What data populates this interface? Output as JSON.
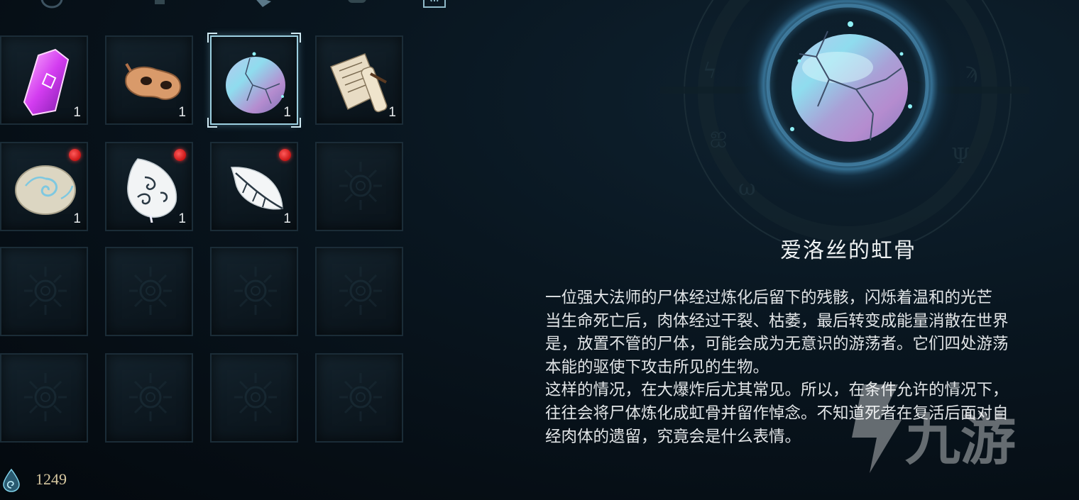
{
  "inventory": {
    "slots": [
      {
        "item": "purple-crystal",
        "count": "1",
        "new": false,
        "selected": false
      },
      {
        "item": "bronze-mask",
        "count": "1",
        "new": false,
        "selected": false
      },
      {
        "item": "rainbow-bone-orb",
        "count": "1",
        "new": false,
        "selected": true
      },
      {
        "item": "paper-scroll",
        "count": "1",
        "new": false,
        "selected": false
      },
      {
        "item": "swirl-stone",
        "count": "1",
        "new": true,
        "selected": false
      },
      {
        "item": "ornate-white-leaf",
        "count": "1",
        "new": true,
        "selected": false
      },
      {
        "item": "white-feather",
        "count": "1",
        "new": true,
        "selected": false
      },
      {
        "item": null
      },
      {
        "item": null
      },
      {
        "item": null
      },
      {
        "item": null
      },
      {
        "item": null
      },
      {
        "item": null
      },
      {
        "item": null
      },
      {
        "item": null
      },
      {
        "item": null
      }
    ]
  },
  "currency": {
    "icon": "soul-drop-icon",
    "amount": "1249"
  },
  "detail": {
    "name": "爱洛丝的虹骨",
    "description_lines": [
      "一位强大法师的尸体经过炼化后留下的残骸，闪烁着温和的光芒",
      "当生命死亡后，肉体经过干裂、枯萎，最后转变成能量消散在世界",
      "是，放置不管的尸体，可能会成为无意识的游荡者。它们四处游荡",
      "本能的驱使下攻击所见的生物。",
      "这样的情况，在大爆炸后尤其常见。所以，在条件允许的情况下，",
      "往往会将尸体炼化成虹骨并留作悼念。不知道死者在复活后面对自",
      "经肉体的遗留，究竟会是什么表情。"
    ]
  },
  "watermark": {
    "text": "九游"
  },
  "colors": {
    "selected_border": "#9ccfe0",
    "new_dot": "#e01d1d",
    "currency_text": "#d8c9a2"
  }
}
